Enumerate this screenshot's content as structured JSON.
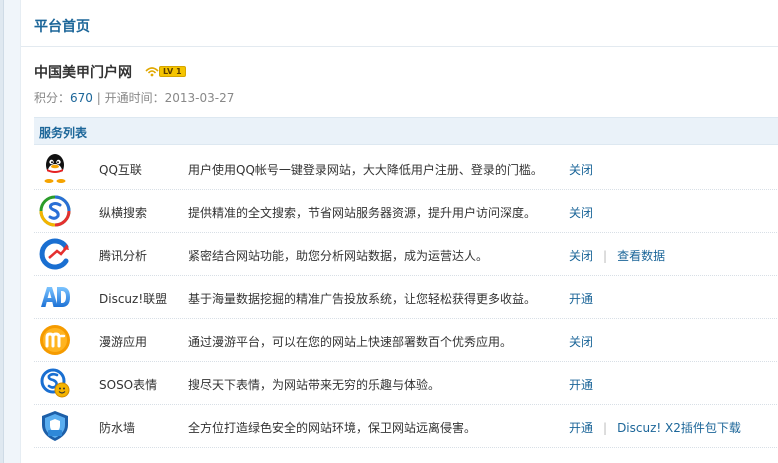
{
  "page": {
    "title": "平台首页"
  },
  "site": {
    "name": "中国美甲门户网",
    "level_badge": "LV 1",
    "points_label": "积分：",
    "points_value": "670",
    "separator": " | ",
    "opened_label": "开通时间：",
    "opened_value": "2013-03-27"
  },
  "services": {
    "heading": "服务列表",
    "items": [
      {
        "name": "QQ互联",
        "icon": "qq-penguin-icon",
        "desc": "用户使用QQ帐号一键登录网站，大大降低用户注册、登录的门槛。",
        "actions": [
          "关闭"
        ]
      },
      {
        "name": "纵横搜索",
        "icon": "soso-search-icon",
        "desc": "提供精准的全文搜索，节省网站服务器资源，提升用户访问深度。",
        "actions": [
          "关闭"
        ]
      },
      {
        "name": "腾讯分析",
        "icon": "tencent-analytics-icon",
        "desc": "紧密结合网站功能，助您分析网站数据，成为运营达人。",
        "actions": [
          "关闭",
          "查看数据"
        ]
      },
      {
        "name": "Discuz!联盟",
        "icon": "ad-union-icon",
        "desc": "基于海量数据挖掘的精准广告投放系统，让您轻松获得更多收益。",
        "actions": [
          "开通"
        ]
      },
      {
        "name": "漫游应用",
        "icon": "manyou-app-icon",
        "desc": "通过漫游平台，可以在您的网站上快速部署数百个优秀应用。",
        "actions": [
          "关闭"
        ]
      },
      {
        "name": "SOSO表情",
        "icon": "soso-emoticon-icon",
        "desc": "搜尽天下表情，为网站带来无穷的乐趣与体验。",
        "actions": [
          "开通"
        ]
      },
      {
        "name": "防水墙",
        "icon": "firewall-shield-icon",
        "desc": "全方位打造绿色安全的网站环境，保卫网站远离侵害。",
        "actions": [
          "开通",
          "Discuz! X2插件包下载"
        ]
      }
    ]
  },
  "colors": {
    "accent": "#1c6699",
    "section_bg": "#eaf2f9",
    "badge": "#f5c400"
  }
}
